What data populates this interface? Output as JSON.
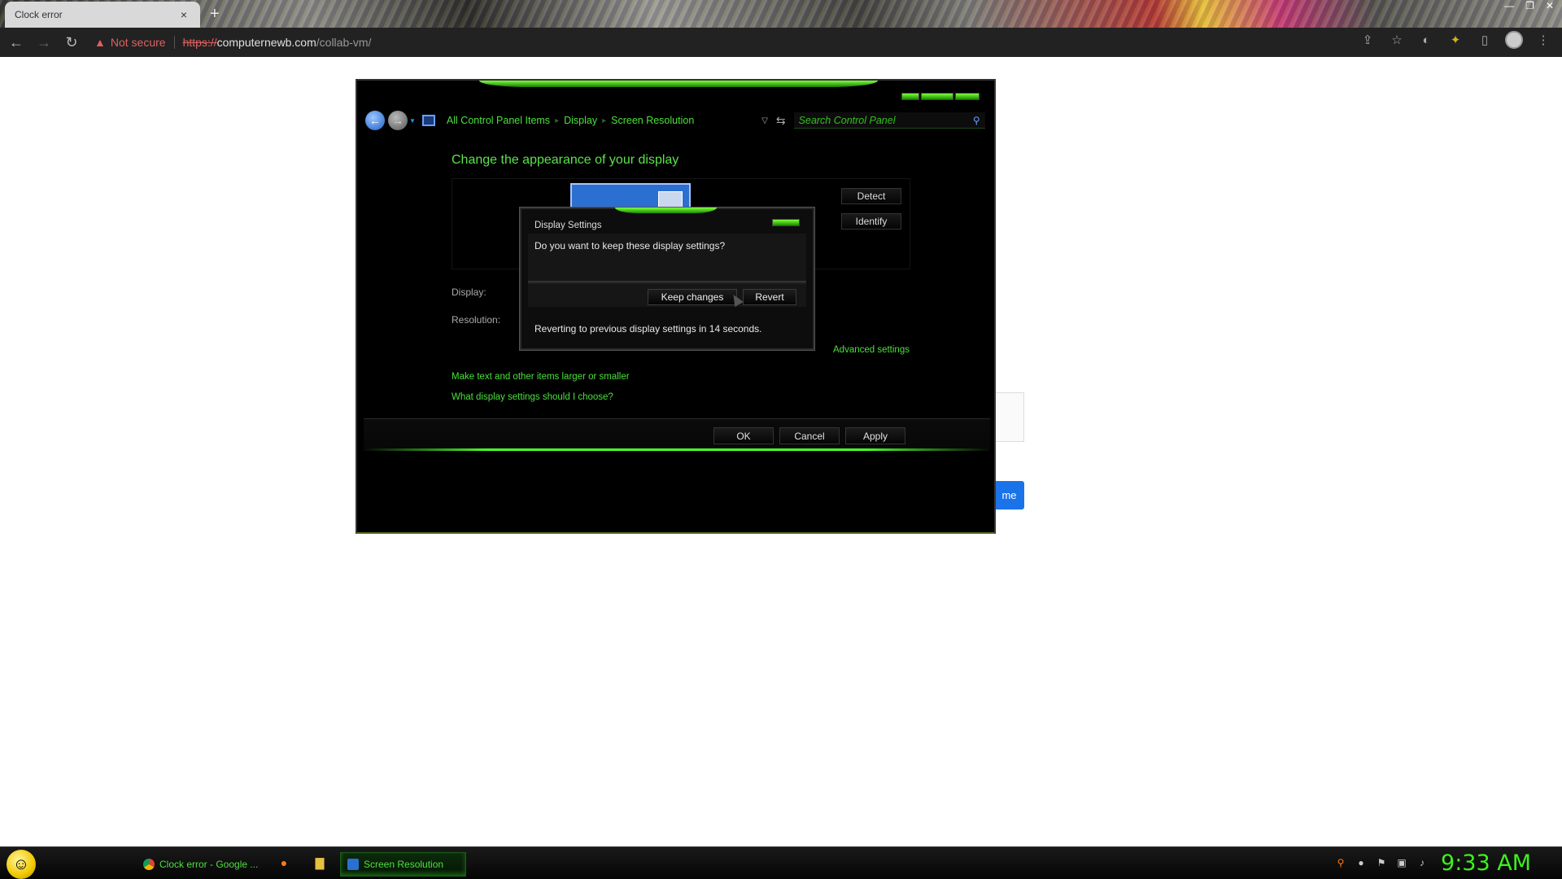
{
  "browser": {
    "tab_title": "Clock error",
    "tab_close": "×",
    "new_tab": "+",
    "url_scheme": "https://",
    "url_host": "computernewb.com",
    "url_path": "/collab-vm/",
    "security_label": "Not secure"
  },
  "page_behind": {
    "blue_button_fragment": "me"
  },
  "vm": {
    "breadcrumbs": [
      "All Control Panel Items",
      "Display",
      "Screen Resolution"
    ],
    "search_placeholder": "Search Control Panel",
    "heading": "Change the appearance of your display",
    "detect_label": "Detect",
    "identify_label": "Identify",
    "display_label": "Display:",
    "resolution_label": "Resolution:",
    "advanced_settings": "Advanced settings",
    "link_text_size": "Make text and other items larger or smaller",
    "link_help": "What display settings should I choose?",
    "ok_label": "OK",
    "cancel_label": "Cancel",
    "apply_label": "Apply",
    "dialog": {
      "title": "Display Settings",
      "question": "Do you want to keep these display settings?",
      "keep_label": "Keep changes",
      "revert_label": "Revert",
      "countdown": "Reverting to previous display settings in 14 seconds."
    }
  },
  "taskbar": {
    "items": [
      "Clock error - Google ...",
      "Screen Resolution"
    ],
    "clock": "9:33 AM"
  },
  "colors": {
    "accent_green": "#4be03c",
    "warn_red": "#e06060",
    "chrome_dark": "#222222",
    "link_blue": "#1a73e8"
  },
  "icons": [
    "back-icon",
    "forward-icon",
    "reload-icon",
    "warning-icon",
    "share-icon",
    "star-icon",
    "extension-icon",
    "sidepanel-icon",
    "profile-icon",
    "menu-icon",
    "search-icon",
    "firefox-icon",
    "folder-icon",
    "smiley-start-icon"
  ]
}
